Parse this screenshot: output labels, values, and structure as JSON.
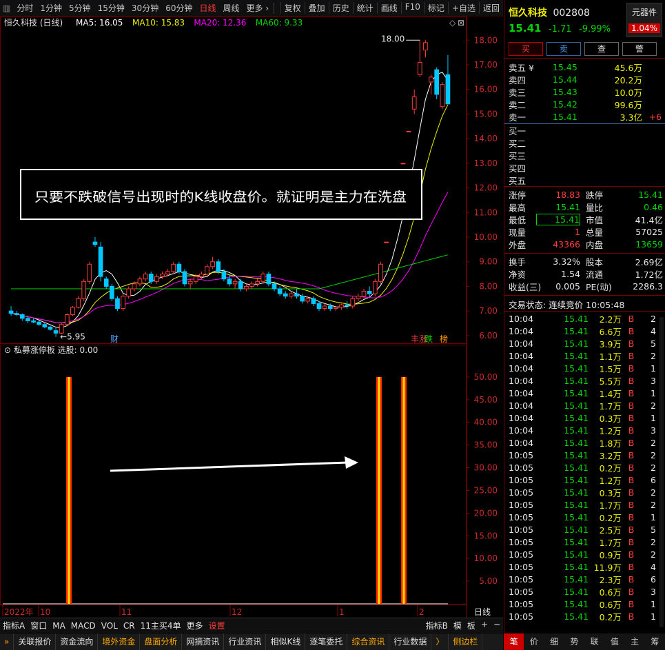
{
  "toolbar": {
    "periods": [
      "分时",
      "1分钟",
      "5分钟",
      "15分钟",
      "30分钟",
      "60分钟",
      "日线",
      "周线",
      "更多 ›"
    ],
    "selected_period": "日线",
    "tools": [
      "复权",
      "叠加",
      "历史",
      "统计",
      "画线",
      "F10",
      "标记",
      "+自选",
      "返回"
    ]
  },
  "chart": {
    "stock_label": "恒久科技 (日线)",
    "ma": [
      {
        "name": "MA5",
        "value": "16.05",
        "color": "#ffffff"
      },
      {
        "name": "MA10",
        "value": "15.83",
        "color": "#f0f000"
      },
      {
        "name": "MA20",
        "value": "12.36",
        "color": "#ff00ff"
      },
      {
        "name": "MA60",
        "value": "9.33",
        "color": "#00d400"
      }
    ],
    "price_axis": [
      "18.00",
      "17.00",
      "16.00",
      "15.00",
      "14.00",
      "13.00",
      "12.00",
      "11.00",
      "10.00",
      "9.00",
      "8.00",
      "7.00",
      "6.00"
    ],
    "high_label": "18.00",
    "low_label": "5.95",
    "annotation": "只要不跌破信号出现时的K线收盘价。就证明是主力在洗盘",
    "markers": {
      "cai": "财",
      "zhang": "涨",
      "die": "跌",
      "bang": "榜"
    }
  },
  "indicator": {
    "title": "私募涨停板",
    "select_label": "选股: 0.00",
    "axis": [
      "50.00",
      "45.00",
      "40.00",
      "35.00",
      "30.00",
      "25.00",
      "20.00",
      "15.00",
      "10.00",
      "5.00"
    ]
  },
  "time_axis": {
    "labels": [
      "2022年",
      "10",
      "11",
      "12",
      "1",
      "2"
    ],
    "period": "日线"
  },
  "bottom_tabs": [
    "指标A",
    "窗口",
    "MA",
    "MACD",
    "VOL",
    "CR",
    "11主买4单",
    "更多",
    "设置"
  ],
  "bottom_right": [
    "指标B",
    "模",
    "板",
    "+",
    "−"
  ],
  "footer_tabs": [
    "关联报价",
    "资金流向",
    "境外资金",
    "盘面分析",
    "网摘资讯",
    "行业资讯",
    "相似K线",
    "逐笔委托",
    "综合资讯",
    "行业数据",
    "〉",
    "侧边栏"
  ],
  "quote": {
    "name": "恒久科技",
    "code": "002808",
    "badge": "元器件",
    "badge_pct": "1.04%",
    "price": "15.41",
    "change": "-1.71",
    "pct": "-9.99%",
    "buttons": [
      "买",
      "卖",
      "查",
      "警"
    ],
    "asks": [
      {
        "label": "卖五 ¥",
        "price": "15.45",
        "vol": "45.6万",
        "delta": ""
      },
      {
        "label": "卖四",
        "price": "15.44",
        "vol": "20.2万",
        "delta": ""
      },
      {
        "label": "卖三",
        "price": "15.43",
        "vol": "10.0万",
        "delta": ""
      },
      {
        "label": "卖二",
        "price": "15.42",
        "vol": "99.6万",
        "delta": ""
      },
      {
        "label": "卖一",
        "price": "15.41",
        "vol": "3.3亿",
        "delta": "+6"
      }
    ],
    "bids": [
      "买一",
      "买二",
      "买三",
      "买四",
      "买五"
    ],
    "stats": [
      {
        "l1": "涨停",
        "v1": "18.83",
        "c1": "r",
        "l2": "跌停",
        "v2": "15.41",
        "c2": "g"
      },
      {
        "l1": "最高",
        "v1": "15.41",
        "c1": "g",
        "l2": "量比",
        "v2": "0.46",
        "c2": "g"
      },
      {
        "l1": "最低",
        "v1": "15.41",
        "c1": "g",
        "l2": "市值",
        "v2": "41.4亿",
        "c2": "w"
      },
      {
        "l1": "现量",
        "v1": "1",
        "c1": "r",
        "l2": "总量",
        "v2": "57025",
        "c2": "w"
      },
      {
        "l1": "外盘",
        "v1": "43366",
        "c1": "r",
        "l2": "内盘",
        "v2": "13659",
        "c2": "g"
      }
    ],
    "stats2": [
      {
        "l1": "换手",
        "v1": "3.32%",
        "l2": "股本",
        "v2": "2.69亿"
      },
      {
        "l1": "净资",
        "v1": "1.54",
        "l2": "流通",
        "v2": "1.72亿"
      },
      {
        "l1": "收益(三)",
        "v1": "0.005",
        "l2": "PE(动)",
        "v2": "2286.3"
      }
    ],
    "status": "交易状态: 连续竞价 10:05:48"
  },
  "trades": [
    {
      "t": "10:04",
      "p": "15.41",
      "v": "2.2万",
      "s": "B",
      "n": "2"
    },
    {
      "t": "10:04",
      "p": "15.41",
      "v": "6.6万",
      "s": "B",
      "n": "4"
    },
    {
      "t": "10:04",
      "p": "15.41",
      "v": "3.9万",
      "s": "B",
      "n": "5"
    },
    {
      "t": "10:04",
      "p": "15.41",
      "v": "1.1万",
      "s": "B",
      "n": "2"
    },
    {
      "t": "10:04",
      "p": "15.41",
      "v": "1.5万",
      "s": "B",
      "n": "1"
    },
    {
      "t": "10:04",
      "p": "15.41",
      "v": "5.5万",
      "s": "B",
      "n": "3"
    },
    {
      "t": "10:04",
      "p": "15.41",
      "v": "1.4万",
      "s": "B",
      "n": "1"
    },
    {
      "t": "10:04",
      "p": "15.41",
      "v": "1.7万",
      "s": "B",
      "n": "2"
    },
    {
      "t": "10:04",
      "p": "15.41",
      "v": "0.3万",
      "s": "B",
      "n": "1"
    },
    {
      "t": "10:04",
      "p": "15.41",
      "v": "1.2万",
      "s": "B",
      "n": "3"
    },
    {
      "t": "10:04",
      "p": "15.41",
      "v": "1.8万",
      "s": "B",
      "n": "2"
    },
    {
      "t": "10:05",
      "p": "15.41",
      "v": "3.2万",
      "s": "B",
      "n": "2"
    },
    {
      "t": "10:05",
      "p": "15.41",
      "v": "0.2万",
      "s": "B",
      "n": "2"
    },
    {
      "t": "10:05",
      "p": "15.41",
      "v": "1.2万",
      "s": "B",
      "n": "6"
    },
    {
      "t": "10:05",
      "p": "15.41",
      "v": "0.3万",
      "s": "B",
      "n": "2"
    },
    {
      "t": "10:05",
      "p": "15.41",
      "v": "1.7万",
      "s": "B",
      "n": "2"
    },
    {
      "t": "10:05",
      "p": "15.41",
      "v": "0.2万",
      "s": "B",
      "n": "1"
    },
    {
      "t": "10:05",
      "p": "15.41",
      "v": "2.5万",
      "s": "B",
      "n": "5"
    },
    {
      "t": "10:05",
      "p": "15.41",
      "v": "1.7万",
      "s": "B",
      "n": "2"
    },
    {
      "t": "10:05",
      "p": "15.41",
      "v": "0.9万",
      "s": "B",
      "n": "2"
    },
    {
      "t": "10:05",
      "p": "15.41",
      "v": "11.9万",
      "s": "B",
      "n": "4"
    },
    {
      "t": "10:05",
      "p": "15.41",
      "v": "2.3万",
      "s": "B",
      "n": "6"
    },
    {
      "t": "10:05",
      "p": "15.41",
      "v": "0.6万",
      "s": "B",
      "n": "3"
    },
    {
      "t": "10:05",
      "p": "15.41",
      "v": "0.6万",
      "s": "B",
      "n": "1"
    },
    {
      "t": "10:05",
      "p": "15.41",
      "v": "0.2万",
      "s": "B",
      "n": "1"
    }
  ],
  "side_tabs": [
    "笔",
    "价",
    "细",
    "势",
    "联",
    "值",
    "主",
    "筹"
  ],
  "chart_data": {
    "type": "candlestick",
    "ylim": [
      5.8,
      18.4
    ],
    "candles": [
      [
        7.0,
        7.2,
        6.8,
        6.9
      ],
      [
        6.9,
        7.0,
        6.8,
        6.85
      ],
      [
        6.85,
        6.9,
        6.6,
        6.7
      ],
      [
        6.7,
        6.8,
        6.5,
        6.6
      ],
      [
        6.6,
        6.7,
        6.5,
        6.55
      ],
      [
        6.55,
        6.6,
        6.4,
        6.45
      ],
      [
        6.45,
        6.5,
        6.3,
        6.35
      ],
      [
        6.35,
        6.4,
        6.2,
        6.25
      ],
      [
        6.2,
        6.3,
        5.95,
        6.1
      ],
      [
        6.1,
        6.5,
        6.05,
        6.45
      ],
      [
        6.45,
        6.9,
        6.4,
        6.85
      ],
      [
        6.85,
        7.2,
        6.8,
        7.15
      ],
      [
        7.15,
        7.6,
        7.1,
        7.5
      ],
      [
        7.5,
        8.3,
        7.4,
        8.2
      ],
      [
        8.2,
        9.0,
        8.1,
        8.9
      ],
      [
        9.8,
        10.0,
        9.6,
        9.7
      ],
      [
        9.6,
        9.8,
        8.2,
        8.4
      ],
      [
        8.3,
        8.4,
        7.9,
        8.0
      ],
      [
        8.0,
        8.1,
        7.4,
        7.5
      ],
      [
        7.5,
        7.6,
        7.0,
        7.1
      ],
      [
        7.1,
        7.7,
        7.0,
        7.6
      ],
      [
        7.6,
        8.0,
        7.5,
        7.9
      ],
      [
        7.9,
        8.2,
        7.8,
        8.1
      ],
      [
        8.1,
        8.4,
        8.0,
        8.3
      ],
      [
        8.3,
        8.6,
        8.2,
        8.5
      ],
      [
        8.5,
        8.6,
        8.1,
        8.2
      ],
      [
        8.2,
        8.5,
        8.1,
        8.4
      ],
      [
        8.4,
        8.6,
        8.3,
        8.5
      ],
      [
        8.5,
        8.7,
        8.4,
        8.6
      ],
      [
        8.6,
        9.0,
        8.5,
        8.9
      ],
      [
        8.9,
        9.0,
        8.5,
        8.6
      ],
      [
        8.6,
        8.7,
        8.0,
        8.1
      ],
      [
        8.1,
        8.3,
        7.9,
        8.2
      ],
      [
        8.2,
        8.5,
        8.1,
        8.4
      ],
      [
        8.4,
        8.6,
        8.3,
        8.5
      ],
      [
        8.5,
        8.9,
        8.4,
        8.8
      ],
      [
        8.8,
        9.2,
        8.7,
        9.0
      ],
      [
        9.0,
        9.1,
        8.5,
        8.6
      ],
      [
        8.6,
        8.7,
        8.2,
        8.3
      ],
      [
        8.3,
        8.5,
        8.0,
        8.1
      ],
      [
        8.1,
        8.3,
        7.9,
        8.2
      ],
      [
        8.2,
        8.3,
        7.8,
        7.9
      ],
      [
        7.9,
        8.1,
        7.8,
        8.0
      ],
      [
        8.0,
        8.2,
        7.9,
        8.1
      ],
      [
        8.1,
        8.3,
        8.0,
        8.2
      ],
      [
        8.2,
        8.6,
        8.1,
        8.5
      ],
      [
        8.5,
        8.6,
        8.0,
        8.1
      ],
      [
        8.1,
        8.2,
        7.8,
        7.9
      ],
      [
        7.9,
        8.0,
        7.6,
        7.7
      ],
      [
        7.7,
        7.8,
        7.5,
        7.6
      ],
      [
        7.6,
        7.8,
        7.5,
        7.7
      ],
      [
        7.7,
        7.9,
        7.5,
        7.6
      ],
      [
        7.6,
        7.7,
        7.3,
        7.4
      ],
      [
        7.4,
        7.6,
        7.3,
        7.5
      ],
      [
        7.5,
        7.6,
        7.2,
        7.3
      ],
      [
        7.3,
        7.4,
        7.0,
        7.1
      ],
      [
        7.1,
        7.3,
        7.0,
        7.2
      ],
      [
        7.2,
        7.3,
        7.0,
        7.1
      ],
      [
        7.1,
        7.2,
        7.0,
        7.15
      ],
      [
        7.15,
        7.3,
        7.05,
        7.25
      ],
      [
        7.25,
        7.4,
        7.1,
        7.2
      ],
      [
        7.2,
        7.6,
        7.1,
        7.5
      ],
      [
        7.5,
        7.7,
        7.4,
        7.6
      ],
      [
        7.6,
        7.9,
        7.5,
        7.8
      ],
      [
        7.8,
        8.0,
        7.6,
        7.7
      ],
      [
        7.7,
        8.3,
        7.6,
        8.2
      ],
      [
        8.2,
        9.0,
        8.1,
        8.9
      ],
      [
        9.8,
        9.8,
        9.8,
        9.8
      ],
      [
        10.8,
        10.8,
        10.8,
        10.8
      ],
      [
        11.9,
        11.9,
        11.9,
        11.9
      ],
      [
        13.0,
        13.0,
        13.0,
        13.0
      ],
      [
        14.3,
        14.3,
        14.3,
        14.3
      ],
      [
        15.2,
        16.0,
        15.0,
        15.7
      ],
      [
        16.6,
        18.0,
        16.5,
        17.1
      ],
      [
        17.6,
        18.0,
        17.3,
        17.9
      ],
      [
        16.3,
        16.6,
        15.8,
        16.5
      ],
      [
        16.8,
        16.9,
        15.6,
        15.8
      ],
      [
        15.3,
        16.3,
        15.2,
        16.2
      ],
      [
        16.6,
        17.4,
        15.4,
        15.41
      ]
    ],
    "signals": [
      0.08,
      0.76,
      0.81
    ],
    "signal_value": 50
  }
}
